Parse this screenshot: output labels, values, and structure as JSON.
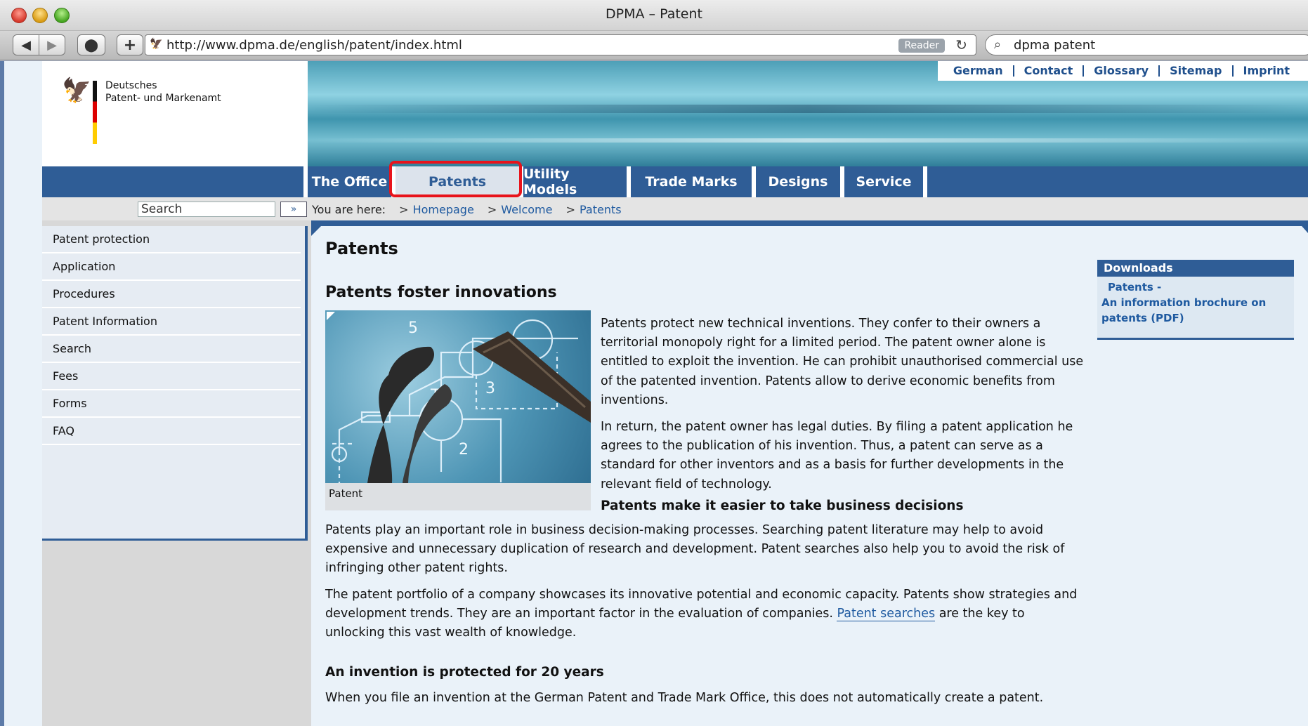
{
  "window": {
    "title": "DPMA – Patent"
  },
  "toolbar": {
    "url": "http://www.dpma.de/english/patent/index.html",
    "reader_label": "Reader",
    "search_query": "dpma patent"
  },
  "logo": {
    "line1": "Deutsches",
    "line2": "Patent- und Markenamt"
  },
  "utility_nav": [
    "German",
    "Contact",
    "Glossary",
    "Sitemap",
    "Imprint"
  ],
  "main_nav": [
    "The Office",
    "Patents",
    "Utility Models",
    "Trade Marks",
    "Designs",
    "Service"
  ],
  "site_search": {
    "placeholder": "Search",
    "button": "»"
  },
  "breadcrumb": {
    "prefix": "You are here:",
    "items": [
      "Homepage",
      "Welcome",
      "Patents"
    ]
  },
  "sidebar": [
    "Patent protection",
    "Application",
    "Procedures",
    "Patent Information",
    "Search",
    "Fees",
    "Forms",
    "FAQ"
  ],
  "content": {
    "title": "Patents",
    "section1_heading": "Patents foster innovations",
    "figure_caption": "Patent",
    "p1": "Patents protect new technical inventions. They confer to their owners a territorial monopoly right for a limited period. The patent owner alone is entitled to exploit the invention. He can prohibit unauthorised commercial use of the patented invention. Patents allow to derive economic benefits from inventions.",
    "p2": "In return, the patent owner has legal duties. By filing a patent application he agrees to the publication of his invention. Thus, a patent can serve as a standard for other inventors and as a basis for further developments in the relevant field of technology.",
    "section2_heading": "Patents make it easier to take business decisions",
    "p3": "Patents play an important role in business decision-making processes. Searching patent literature may help to avoid expensive and unnecessary duplication of research and development. Patent searches also help you to avoid the risk of infringing other patent rights.",
    "p4_before": "The patent portfolio of a company showcases its innovative potential and economic capacity. Patents show strategies and development trends. They are an important factor in the evaluation of companies. ",
    "p4_link": "Patent searches",
    "p4_after": " are the key to unlocking this vast wealth of knowledge.",
    "section3_heading": "An invention is protected for 20 years",
    "p5": "When you file an invention at the German Patent and Trade Mark Office, this does not automatically create a patent."
  },
  "downloads": {
    "heading": "Downloads",
    "link_line1": "Patents -",
    "link_line2": "An information brochure on patents (PDF)"
  },
  "colors": {
    "nav_blue": "#2f5d96",
    "link_blue": "#1f5aa0",
    "highlight_red": "#e8131b"
  }
}
